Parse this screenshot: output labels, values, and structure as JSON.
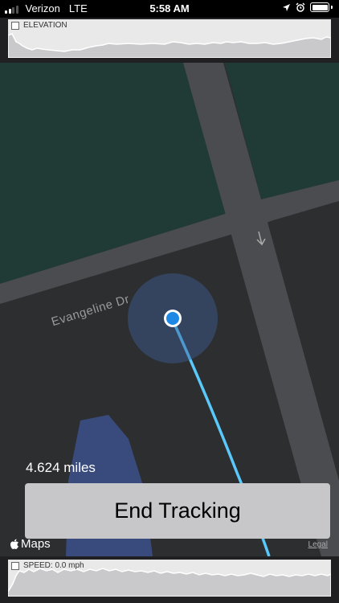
{
  "status": {
    "carrier": "Verizon",
    "network": "LTE",
    "time": "5:58 AM"
  },
  "elevation": {
    "label": "ELEVATION"
  },
  "speed": {
    "label": "SPEED: 0.0 mph"
  },
  "map": {
    "street": "Evangeline Dr",
    "brand": "Maps",
    "legal": "Legal"
  },
  "tracking": {
    "distance": "4.624 miles",
    "end_button": "End Tracking"
  },
  "colors": {
    "route": "#5ac8fa",
    "location_dot": "#1e88e5",
    "map_bg": "#2d2e30",
    "park": "#203a35",
    "road": "#4a4c4f",
    "water": "#394a7d",
    "button_bg": "#c7c7c9"
  },
  "icons": [
    "location-arrow-icon",
    "alarm-icon",
    "battery-icon",
    "signal-icon",
    "apple-logo-icon",
    "direction-arrow-icon"
  ]
}
